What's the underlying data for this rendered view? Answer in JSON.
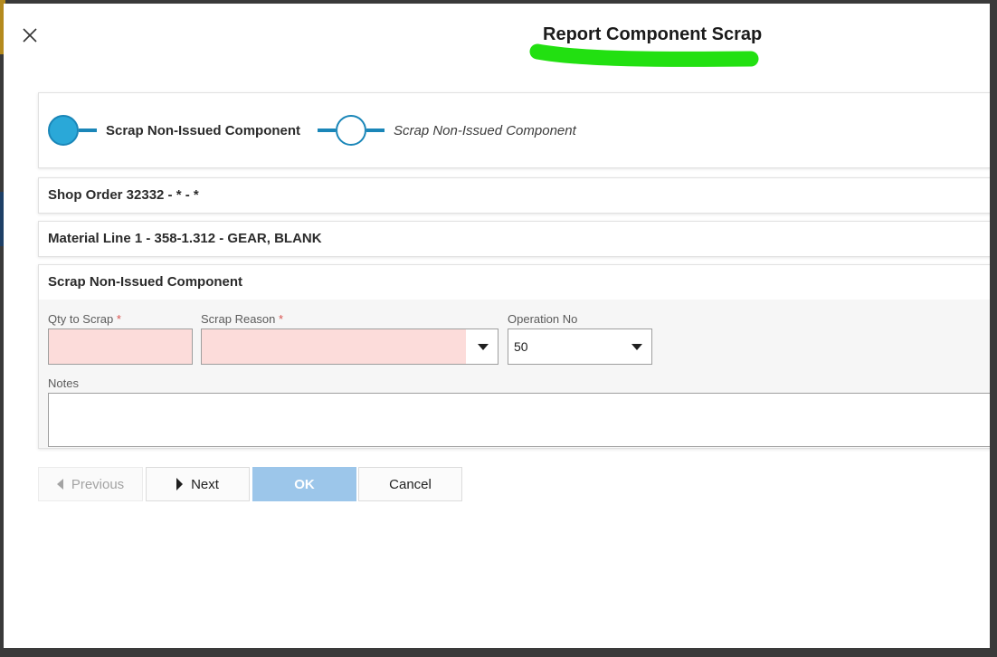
{
  "dialog": {
    "title": "Report Component Scrap",
    "highlight_color": "#22e011"
  },
  "stepper": {
    "steps": [
      {
        "label": "Scrap Non-Issued Component",
        "state": "active"
      },
      {
        "label": "Scrap Non-Issued Component",
        "state": "pending"
      }
    ],
    "accent_color": "#1a86b8"
  },
  "sections": {
    "shop_order": "Shop Order 32332 - * - *",
    "material_line": "Material Line 1 - 358-1.312 - GEAR, BLANK"
  },
  "form": {
    "title": "Scrap Non-Issued Component",
    "qty_to_scrap": {
      "label": "Qty to Scrap",
      "required_mark": "*",
      "value": ""
    },
    "scrap_reason": {
      "label": "Scrap Reason",
      "required_mark": "*",
      "value": ""
    },
    "operation_no": {
      "label": "Operation No",
      "value": "50"
    },
    "notes": {
      "label": "Notes",
      "value": ""
    }
  },
  "buttons": {
    "previous": "Previous",
    "next": "Next",
    "ok": "OK",
    "cancel": "Cancel"
  },
  "icons": [
    "close-icon",
    "chevron-down-icon",
    "caret-left-icon",
    "caret-right-icon"
  ]
}
